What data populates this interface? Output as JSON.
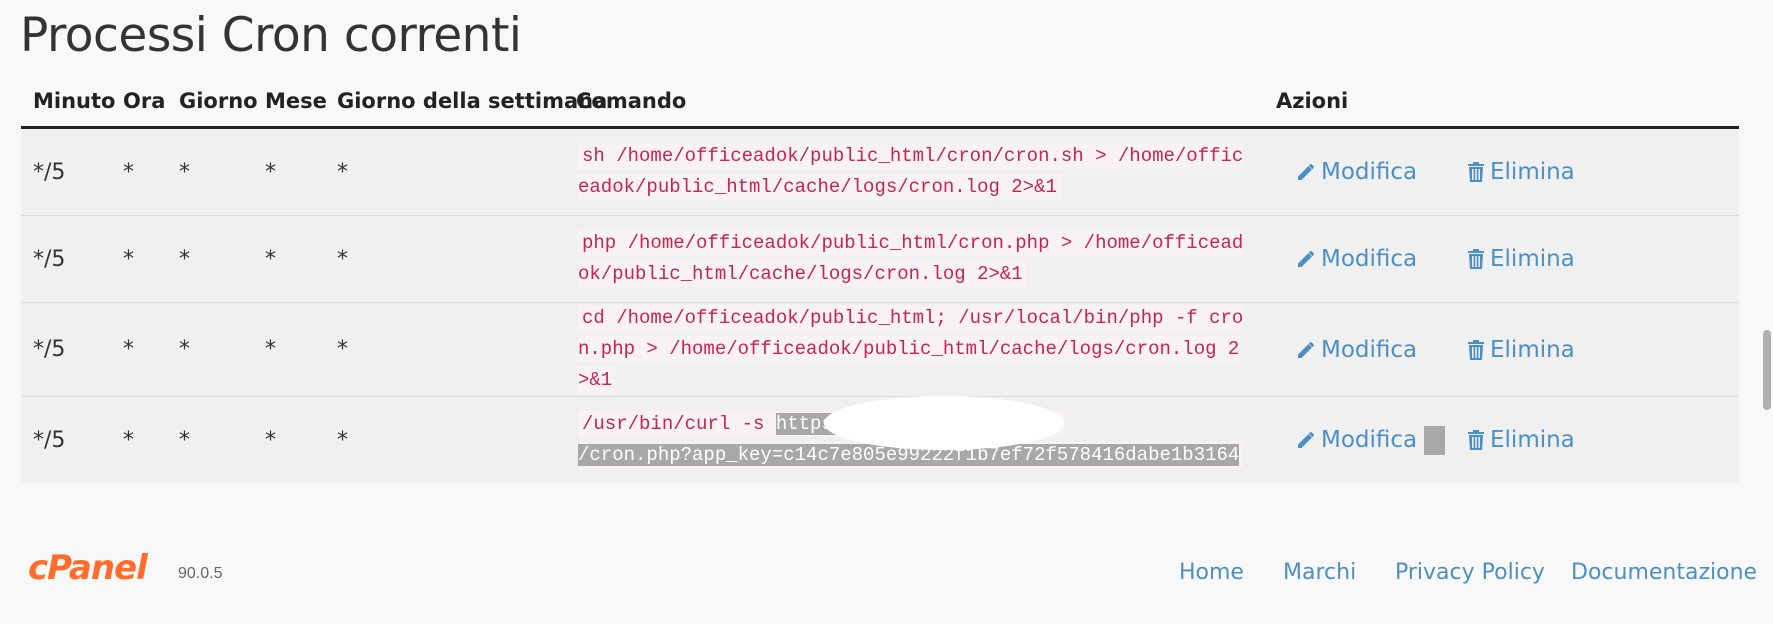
{
  "page": {
    "title": "Processi Cron correnti"
  },
  "table": {
    "headers": {
      "minute": "Minuto",
      "hour": "Ora",
      "day": "Giorno",
      "month": "Mese",
      "weekday": "Giorno della settimana",
      "command": "Comando",
      "actions": "Azioni"
    },
    "rows": [
      {
        "minute": "*/5",
        "hour": "*",
        "day": "*",
        "month": "*",
        "weekday": "*",
        "command": "sh /home/officeadok/public_html/cron/cron.sh > /home/officeadok/public_html/cache/logs/cron.log 2>&1"
      },
      {
        "minute": "*/5",
        "hour": "*",
        "day": "*",
        "month": "*",
        "weekday": "*",
        "command": "php /home/officeadok/public_html/cron.php > /home/officeadok/public_html/cache/logs/cron.log 2>&1"
      },
      {
        "minute": "*/5",
        "hour": "*",
        "day": "*",
        "month": "*",
        "weekday": "*",
        "command": "cd /home/officeadok/public_html; /usr/local/bin/php -f cron.php > /home/officeadok/public_html/cache/logs/cron.log 2>&1"
      },
      {
        "minute": "*/5",
        "hour": "*",
        "day": "*",
        "month": "*",
        "weekday": "*",
        "command_prefix": "/usr/bin/curl -s ",
        "command_selected_start": "https:",
        "command_selected_end": "/cron.php?app_key=c14c7e805e99222f1b7ef72f578416dabe1b3164"
      }
    ],
    "edit_label": "Modifica",
    "delete_label": "Elimina"
  },
  "icons": {
    "edit": "pencil-icon",
    "delete": "trash-icon"
  },
  "footer": {
    "brand": "cPanel",
    "version": "90.0.5",
    "links": [
      "Home",
      "Marchi",
      "Privacy Policy",
      "Documentazione"
    ]
  },
  "colors": {
    "link": "#4c8fc5",
    "code_text": "#c7254e",
    "code_bg": "#f9f2f4",
    "brand": "#ff6c2c",
    "row_bg": "#f0f0f0"
  }
}
